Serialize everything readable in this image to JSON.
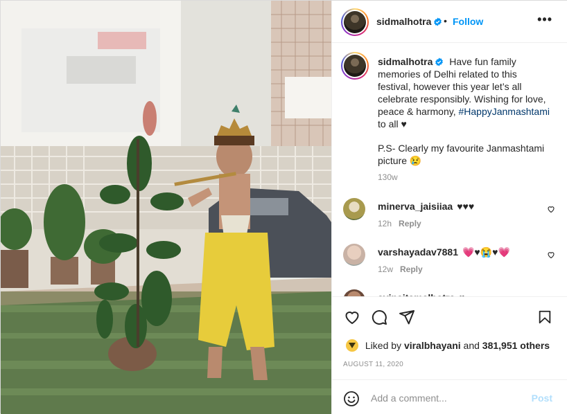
{
  "post": {
    "username": "sidmalhotra",
    "follow_label": "Follow",
    "dot": "•",
    "more_label": "•••",
    "verified_icon": "verified-badge-icon",
    "accent_color": "#0095f6"
  },
  "caption": {
    "username": "sidmalhotra",
    "text_before": "Have fun family memories of Delhi related to this festival, however this year let’s all celebrate responsibly. Wishing for love, peace & harmony,",
    "hashtag": "#HappyJanmashtami",
    "text_after": "to all ♥",
    "ps": "P.S- Clearly my favourite Janmashtami picture 😢",
    "time": "130w"
  },
  "comments": [
    {
      "username": "minerva_jaisiiaa",
      "text": "♥♥♥",
      "time": "12h",
      "reply": "Reply"
    },
    {
      "username": "varshayadav7881",
      "text": "💗♥😭♥💗",
      "time": "12w",
      "reply": "Reply"
    },
    {
      "username": "avinaitamalhotra",
      "text": "♥",
      "time": "",
      "reply": ""
    }
  ],
  "likes": {
    "prefix": "Liked by",
    "user": "viralbhayani",
    "joiner": "and",
    "others": "381,951 others"
  },
  "date": "AUGUST 11, 2020",
  "add_comment": {
    "placeholder": "Add a comment...",
    "post_label": "Post"
  }
}
